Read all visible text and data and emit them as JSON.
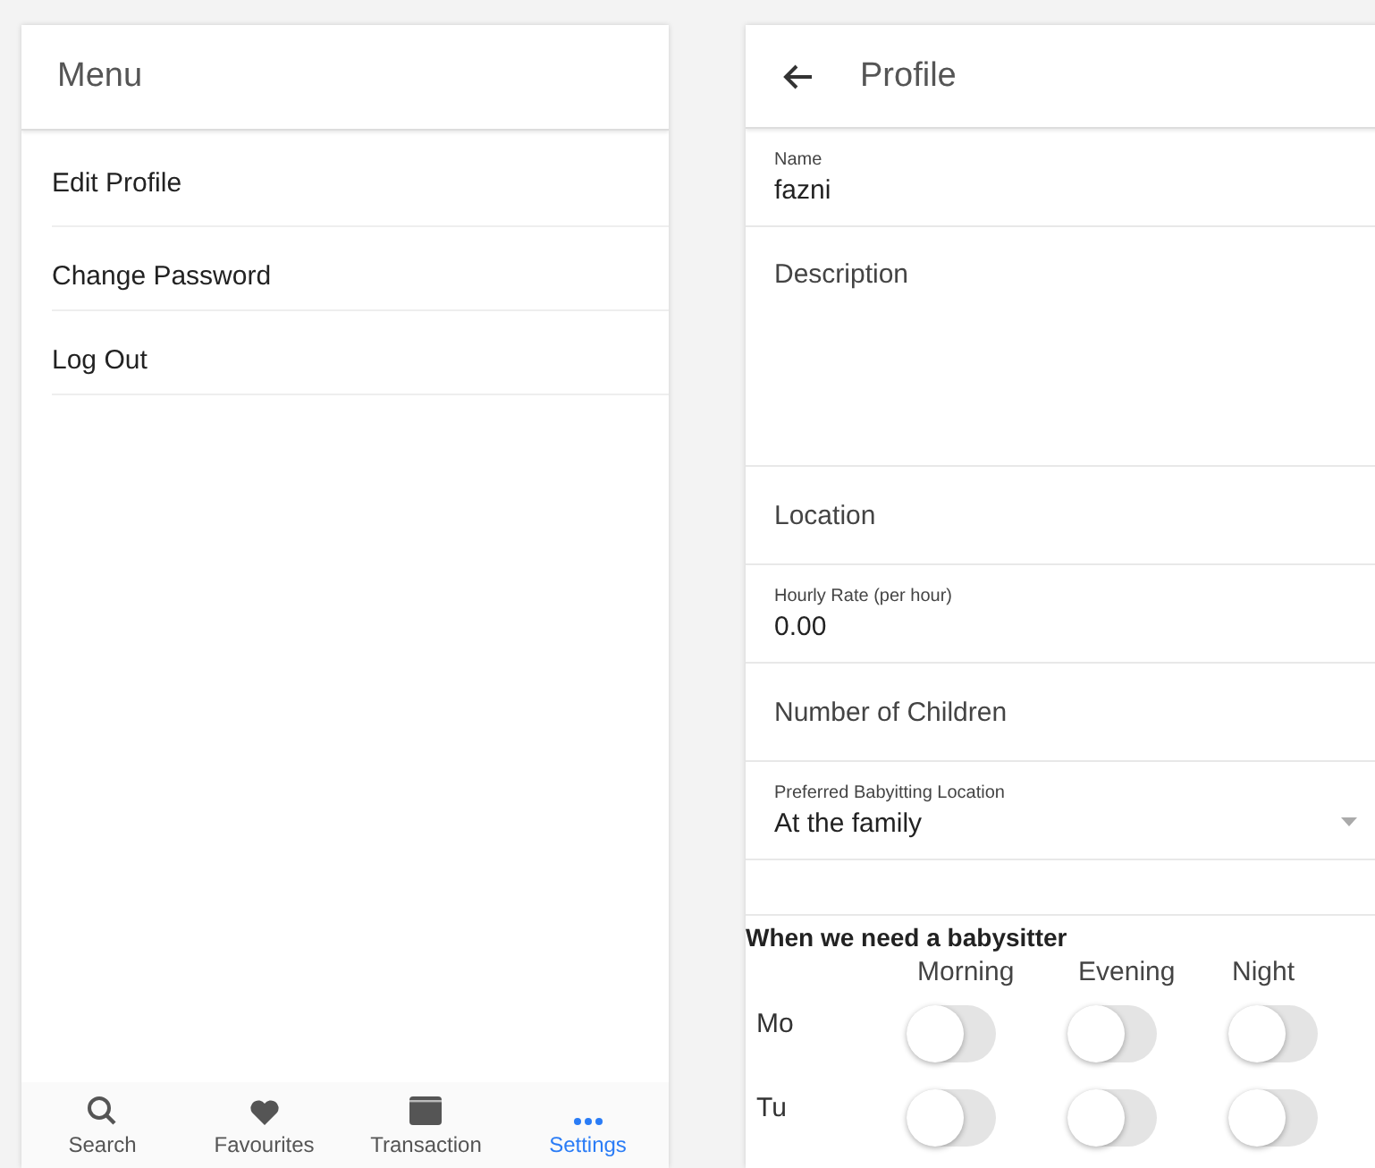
{
  "menu": {
    "title": "Menu",
    "items": [
      {
        "label": "Edit Profile"
      },
      {
        "label": "Change Password"
      },
      {
        "label": "Log Out"
      }
    ]
  },
  "tab_bar": [
    {
      "label": "Search",
      "kind": "search",
      "selected": false
    },
    {
      "label": "Favourites",
      "kind": "heart",
      "selected": false
    },
    {
      "label": "Transaction",
      "kind": "wallet",
      "selected": false
    },
    {
      "label": "Settings",
      "kind": "more",
      "selected": true
    }
  ],
  "profile": {
    "title": "Profile",
    "fields": [
      {
        "kind": "text",
        "label": "Name",
        "value": "fazni"
      },
      {
        "kind": "textarea",
        "placeholder": "Description"
      },
      {
        "kind": "text",
        "placeholder": "Location"
      },
      {
        "kind": "text",
        "label": "Hourly Rate (per hour)",
        "value": "0.00"
      },
      {
        "kind": "text",
        "placeholder": "Number of Children"
      },
      {
        "kind": "select",
        "label": "Preferred Babyitting Location",
        "value": "At the family"
      }
    ],
    "schedule": {
      "title": "When we need a babysitter",
      "columns": [
        "Morning",
        "Evening",
        "Night"
      ],
      "rows": [
        {
          "day": "Mo",
          "slots": [
            {
              "on": false
            },
            {
              "on": false
            },
            {
              "on": false
            }
          ]
        },
        {
          "day": "Tu",
          "slots": [
            {
              "on": false
            },
            {
              "on": false
            },
            {
              "on": false
            }
          ]
        }
      ]
    }
  }
}
